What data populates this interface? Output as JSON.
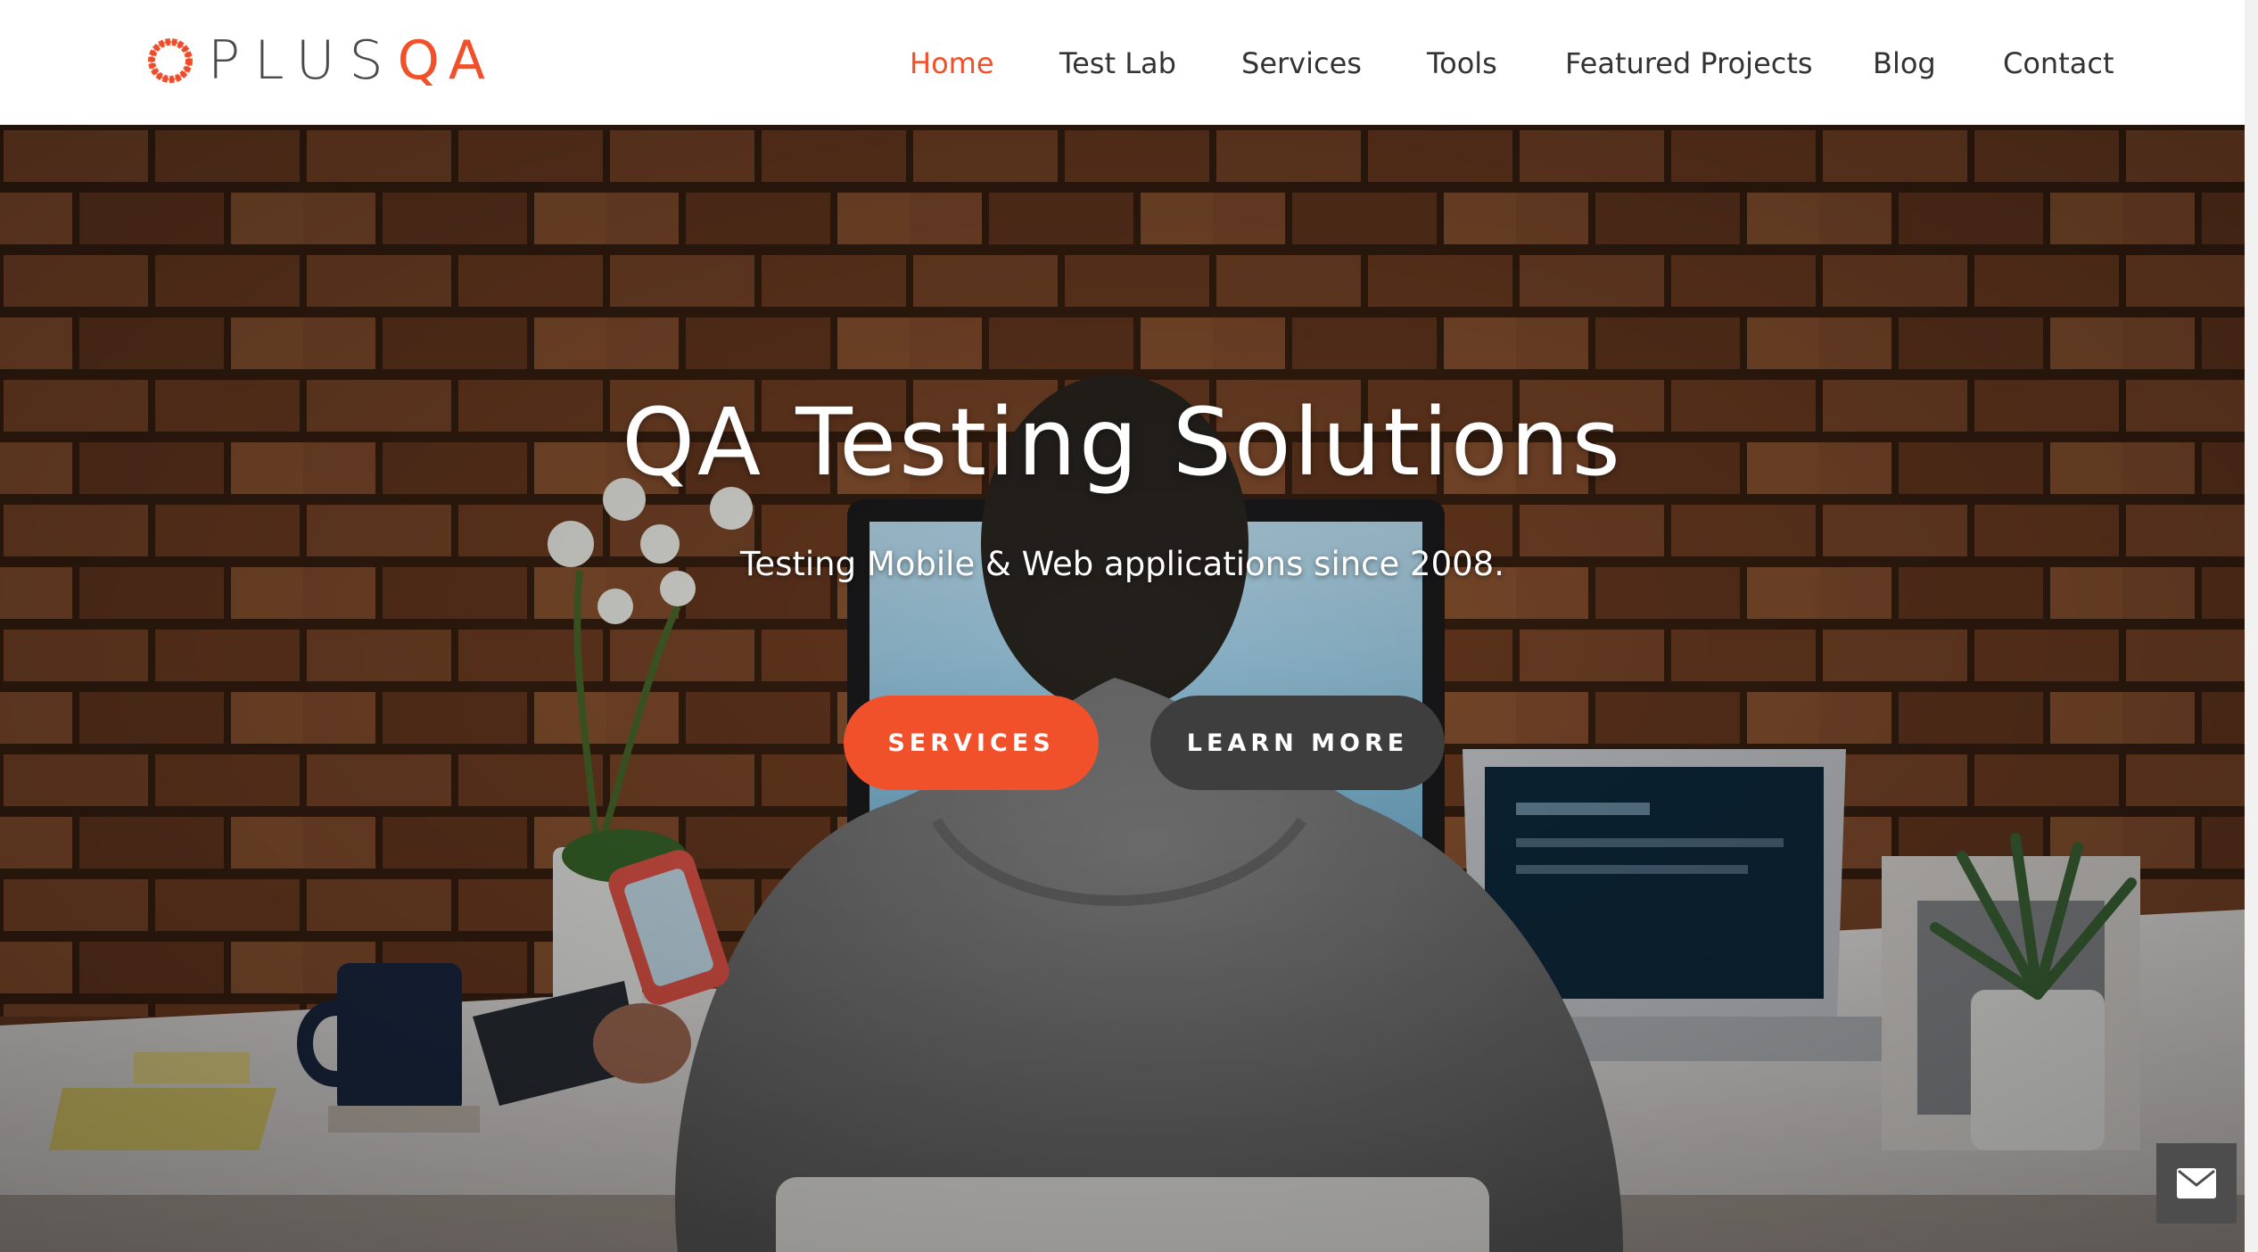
{
  "brand": {
    "logo_plus": "PLUS",
    "logo_qa": "QA",
    "accent_color": "#f0502a",
    "text_color": "#333333"
  },
  "nav": {
    "items": [
      {
        "label": "Home",
        "active": true
      },
      {
        "label": "Test Lab",
        "active": false
      },
      {
        "label": "Services",
        "active": false
      },
      {
        "label": "Tools",
        "active": false
      },
      {
        "label": "Featured Projects",
        "active": false
      },
      {
        "label": "Blog",
        "active": false
      },
      {
        "label": "Contact",
        "active": false
      }
    ]
  },
  "hero": {
    "title": "QA Testing Solutions",
    "subtitle": "Testing Mobile & Web applications since 2008.",
    "primary_button": "SERVICES",
    "secondary_button": "LEARN MORE",
    "primary_button_color": "#f0502a",
    "secondary_button_color": "#3e3e3e"
  },
  "contact_fab": {
    "icon": "envelope-icon"
  }
}
